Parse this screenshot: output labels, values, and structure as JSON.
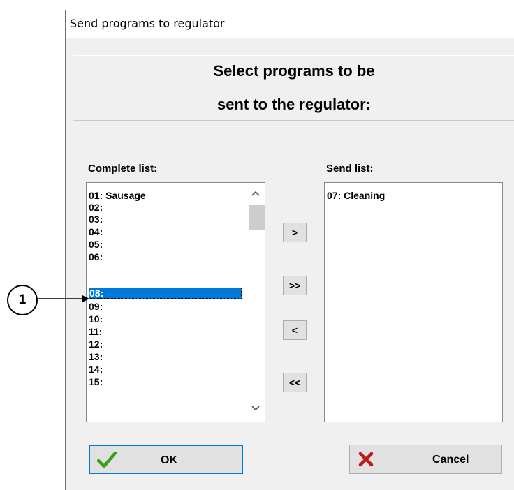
{
  "window": {
    "title": "Send programs to regulator"
  },
  "header": {
    "line1": "Select programs to be",
    "line2": "sent to the regulator:"
  },
  "complete_list": {
    "label": "Complete list:",
    "items": [
      "01: Sausage",
      "02:",
      "03:",
      "04:",
      "05:",
      "06:",
      "08:",
      "09:",
      "10:",
      "11:",
      "12:",
      "13:",
      "14:",
      "15:"
    ],
    "selected": "08:"
  },
  "send_list": {
    "label": "Send list:",
    "items": [
      "07: Cleaning"
    ]
  },
  "move_buttons": {
    "add": ">",
    "add_all": ">>",
    "remove": "<",
    "remove_all": "<<"
  },
  "footer": {
    "ok_label": "OK",
    "cancel_label": "Cancel"
  },
  "annotation": {
    "callout_number": "1"
  },
  "colors": {
    "selection": "#0078d7",
    "ok_check": "#3aa01f",
    "cancel_x": "#c1141b",
    "ok_border": "#0078d7"
  },
  "icons": {
    "scroll_up": "chevron-up",
    "scroll_down": "chevron-down",
    "ok": "check",
    "cancel": "x-mark"
  }
}
